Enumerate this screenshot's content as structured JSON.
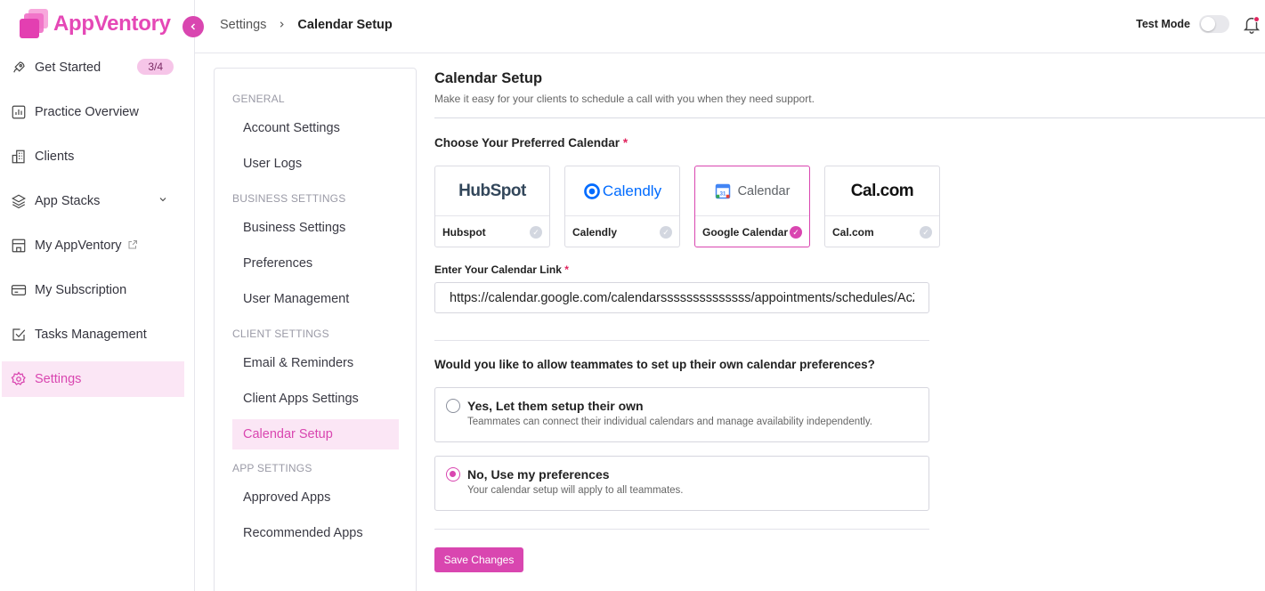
{
  "app": {
    "name": "AppVentory"
  },
  "sidebar": {
    "items": [
      {
        "label": "Get Started",
        "icon": "rocket-icon",
        "badge": "3/4"
      },
      {
        "label": "Practice Overview",
        "icon": "chart-icon"
      },
      {
        "label": "Clients",
        "icon": "building-icon"
      },
      {
        "label": "App Stacks",
        "icon": "layers-icon"
      },
      {
        "label": "My AppVentory",
        "icon": "store-icon"
      },
      {
        "label": "My Subscription",
        "icon": "card-icon"
      },
      {
        "label": "Tasks Management",
        "icon": "checkbox-icon"
      },
      {
        "label": "Settings",
        "icon": "gear-icon"
      }
    ]
  },
  "topbar": {
    "breadcrumb_parent": "Settings",
    "breadcrumb_current": "Calendar Setup",
    "test_mode_label": "Test Mode",
    "test_mode_on": false
  },
  "submenu": {
    "groups": {
      "general": "GENERAL",
      "business": "BUSINESS SETTINGS",
      "client": "CLIENT SETTINGS",
      "app": "APP SETTINGS"
    },
    "items": {
      "account_settings": "Account Settings",
      "user_logs": "User Logs",
      "business_settings": "Business Settings",
      "preferences": "Preferences",
      "user_management": "User Management",
      "email_reminders": "Email & Reminders",
      "client_apps_settings": "Client Apps Settings",
      "calendar_setup": "Calendar Setup",
      "approved_apps": "Approved Apps",
      "recommended_apps": "Recommended Apps"
    }
  },
  "main": {
    "title": "Calendar Setup",
    "subtitle": "Make it easy for your clients to schedule a call with you when they need support.",
    "calendar_section_title": "Choose Your Preferred Calendar",
    "required_mark": "*",
    "calendars": [
      {
        "logo_text": "HubSpot",
        "name": "Hubspot",
        "selected": false
      },
      {
        "logo_text": "Calendly",
        "name": "Calendly",
        "selected": false
      },
      {
        "logo_text": "Calendar",
        "name": "Google Calendar",
        "selected": true
      },
      {
        "logo_text": "Cal.com",
        "name": "Cal.com",
        "selected": false
      }
    ],
    "link_label": "Enter Your Calendar Link",
    "link_value": "https://calendar.google.com/calendarssssssssssssss/appointments/schedules/AcZssZ",
    "teammates_question": "Would you like to allow teammates to set up their own calendar preferences?",
    "options": [
      {
        "title": "Yes, Let them setup their own",
        "desc": "Teammates can connect their individual calendars and manage availability independently.",
        "selected": false
      },
      {
        "title": "No, Use my preferences",
        "desc": "Your calendar setup will apply to all teammates.",
        "selected": true
      }
    ],
    "save_label": "Save Changes"
  },
  "colors": {
    "accent": "#d946b0",
    "accent_light": "#fbe6f5",
    "required": "#e0245e"
  }
}
